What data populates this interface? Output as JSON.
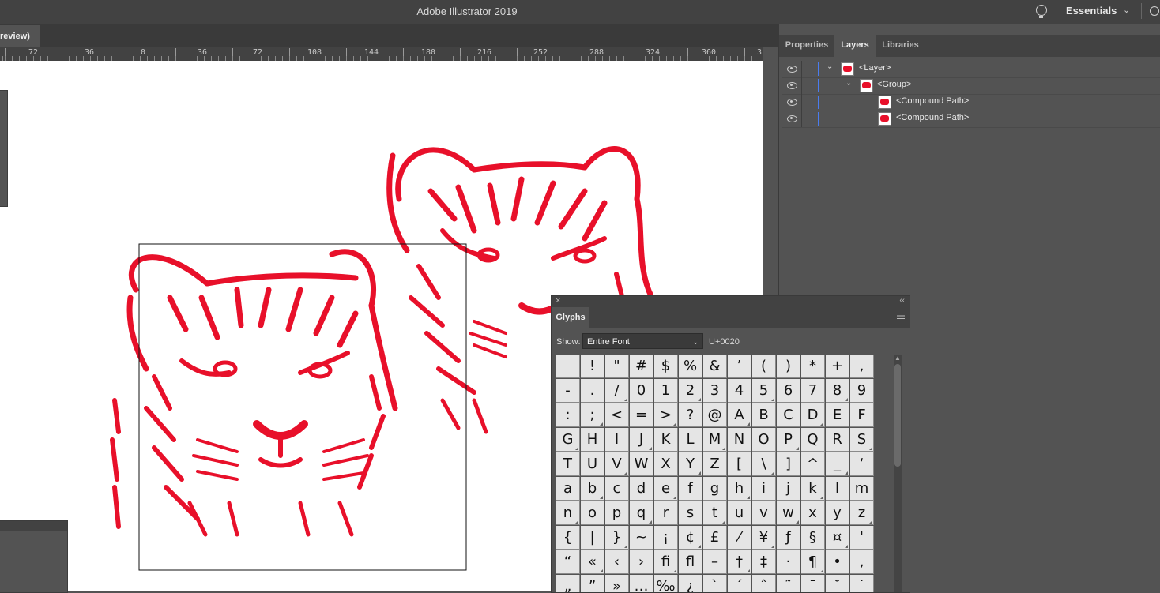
{
  "app_title": "Adobe Illustrator 2019",
  "workspace": {
    "label": "Essentials"
  },
  "document_tab": {
    "label": "review)"
  },
  "ruler": {
    "labels": [
      "72",
      "36",
      "0",
      "36",
      "72",
      "108",
      "144",
      "180",
      "216",
      "252",
      "288",
      "324",
      "360",
      "3"
    ]
  },
  "right_panel": {
    "tabs": [
      {
        "label": "Properties",
        "active": false
      },
      {
        "label": "Layers",
        "active": true
      },
      {
        "label": "Libraries",
        "active": false
      }
    ],
    "layers": [
      {
        "name": "<Layer>",
        "level": 0,
        "expanded": true
      },
      {
        "name": "<Group>",
        "level": 1,
        "expanded": true
      },
      {
        "name": "<Compound Path>",
        "level": 2
      },
      {
        "name": "<Compound Path>",
        "level": 2
      }
    ]
  },
  "glyphs_panel": {
    "title": "Glyphs",
    "show_label": "Show:",
    "show_value": "Entire Font",
    "unicode": "U+0020",
    "rows": [
      [
        " ",
        "!",
        "\"",
        "#",
        "$",
        "%",
        "&",
        "’",
        "(",
        ")",
        "*",
        "+",
        ","
      ],
      [
        "-",
        ".",
        "/",
        "0",
        "1",
        "2",
        "3",
        "4",
        "5",
        "6",
        "7",
        "8",
        "9"
      ],
      [
        ":",
        ";",
        "<",
        "=",
        ">",
        "?",
        "@",
        "A",
        "B",
        "C",
        "D",
        "E",
        "F"
      ],
      [
        "G",
        "H",
        "I",
        "J",
        "K",
        "L",
        "M",
        "N",
        "O",
        "P",
        "Q",
        "R",
        "S"
      ],
      [
        "T",
        "U",
        "V",
        "W",
        "X",
        "Y",
        "Z",
        "[",
        "\\",
        "]",
        "^",
        "_",
        "‘"
      ],
      [
        "a",
        "b",
        "c",
        "d",
        "e",
        "f",
        "g",
        "h",
        "i",
        "j",
        "k",
        "l",
        "m"
      ],
      [
        "n",
        "o",
        "p",
        "q",
        "r",
        "s",
        "t",
        "u",
        "v",
        "w",
        "x",
        "y",
        "z"
      ],
      [
        "{",
        "|",
        "}",
        "~",
        "¡",
        "¢",
        "£",
        "⁄",
        "¥",
        "ƒ",
        "§",
        "¤",
        "'"
      ],
      [
        "“",
        "«",
        "‹",
        "›",
        "ﬁ",
        "ﬂ",
        "–",
        "†",
        "‡",
        "·",
        "¶",
        "•",
        "‚"
      ],
      [
        "„",
        "”",
        "»",
        "…",
        "‰",
        "¿",
        "`",
        "´",
        "ˆ",
        "˜",
        "¯",
        "˘",
        "˙"
      ]
    ]
  },
  "colors": {
    "artwork": "#e8102a",
    "layer_color": "#4a7cf0",
    "ui_dark": "#424242",
    "ui_mid": "#535353"
  }
}
